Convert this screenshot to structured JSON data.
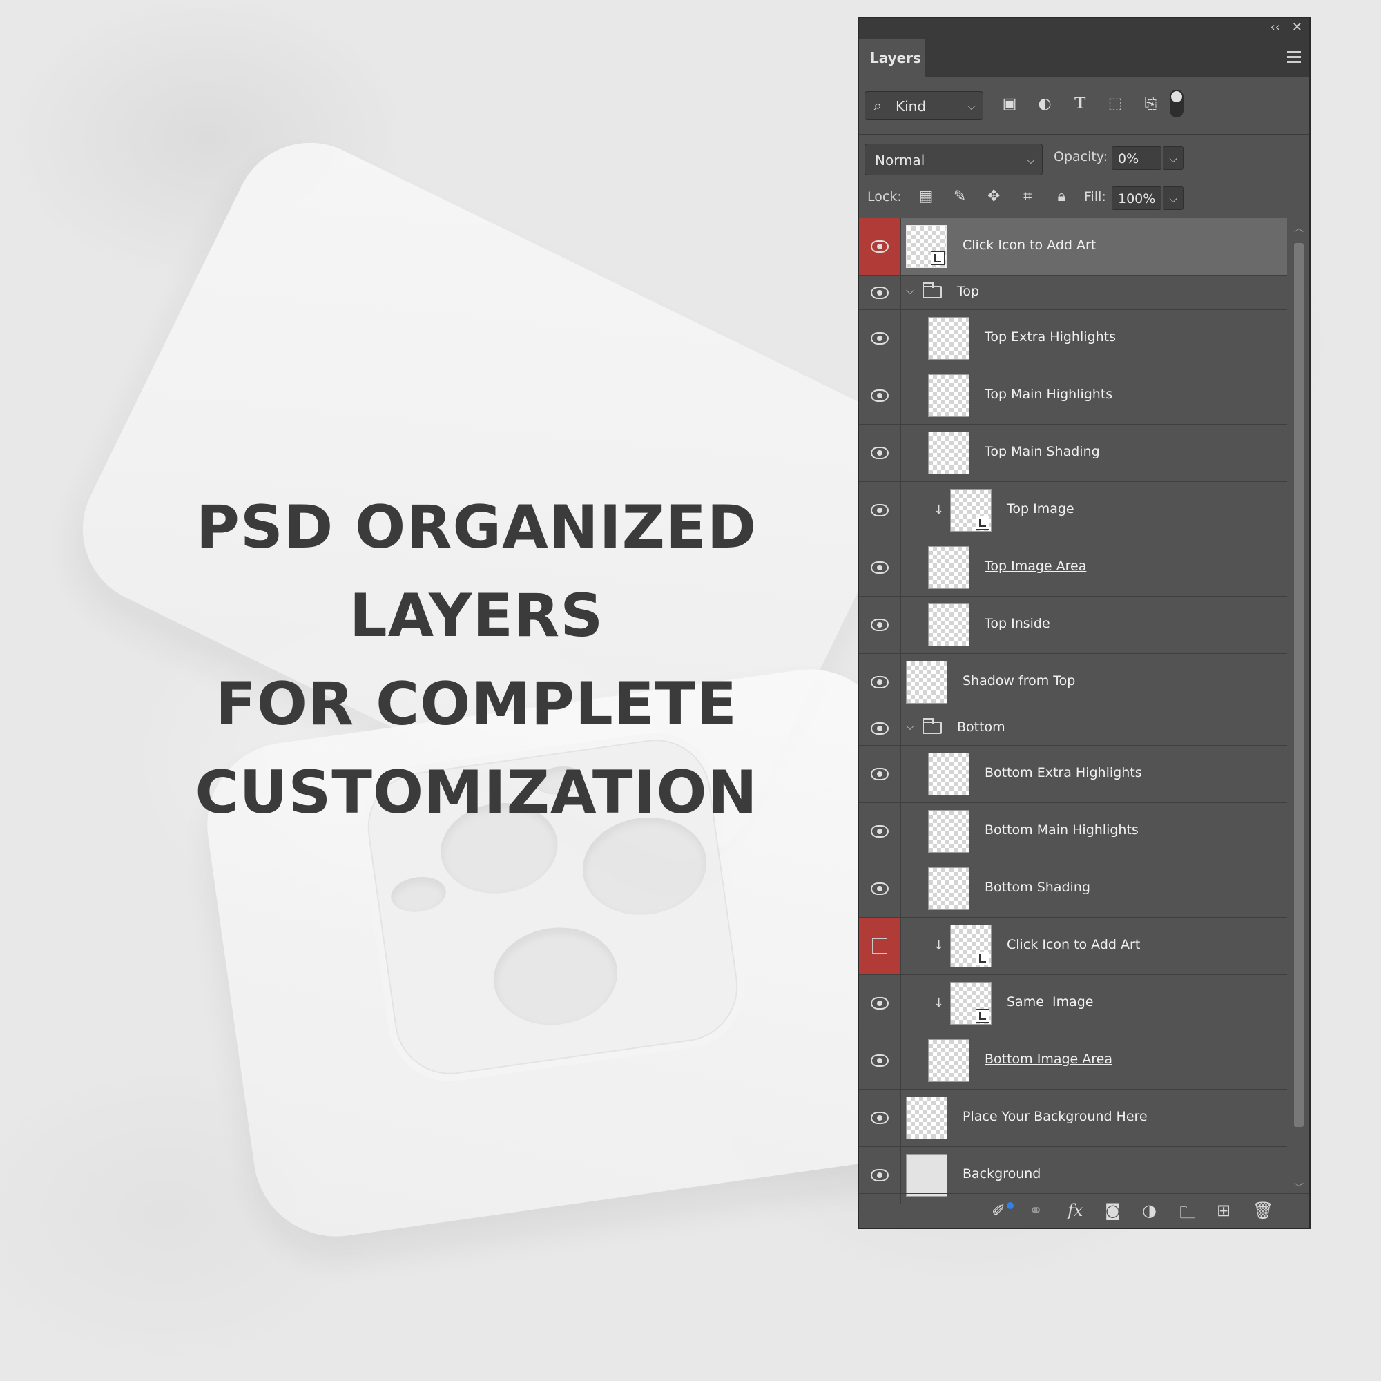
{
  "headline": {
    "line1": "PSD ORGANIZED LAYERS",
    "line2": "FOR COMPLETE",
    "line3": "CUSTOMIZATION"
  },
  "panel": {
    "title": "Layers",
    "collapse_glyph": "‹‹",
    "close_glyph": "✕",
    "filter": {
      "kind_label": "Kind"
    },
    "blend_mode": "Normal",
    "opacity_label": "Opacity:",
    "opacity_value": "0%",
    "lock_label": "Lock:",
    "fill_label": "Fill:",
    "fill_value": "100%"
  },
  "layers": [
    {
      "name": "Click Icon to Add Art",
      "type": "smart",
      "indent": 0,
      "selected": true,
      "visible": true,
      "red_eye": true
    },
    {
      "name": "Top",
      "type": "group",
      "indent": 0,
      "visible": true
    },
    {
      "name": "Top Extra Highlights",
      "type": "layer",
      "indent": 1,
      "visible": true
    },
    {
      "name": "Top Main Highlights",
      "type": "layer",
      "indent": 1,
      "visible": true
    },
    {
      "name": "Top Main Shading",
      "type": "layer",
      "indent": 1,
      "visible": true
    },
    {
      "name": "Top Image",
      "type": "smart",
      "indent": 2,
      "clipped": true,
      "visible": true
    },
    {
      "name": "Top Image Area",
      "type": "layer",
      "indent": 1,
      "underline": true,
      "visible": true
    },
    {
      "name": "Top Inside",
      "type": "layer",
      "indent": 1,
      "visible": true
    },
    {
      "name": "Shadow from Top",
      "type": "layer",
      "indent": 0,
      "visible": true
    },
    {
      "name": "Bottom",
      "type": "group",
      "indent": 0,
      "visible": true
    },
    {
      "name": "Bottom Extra Highlights",
      "type": "layer",
      "indent": 1,
      "visible": true
    },
    {
      "name": "Bottom Main Highlights",
      "type": "layer",
      "indent": 1,
      "visible": true
    },
    {
      "name": "Bottom Shading",
      "type": "layer",
      "indent": 1,
      "visible": true
    },
    {
      "name": "Click Icon to Add Art",
      "type": "smart",
      "indent": 2,
      "clipped": true,
      "visible": false,
      "red_eye": true
    },
    {
      "name": "Same  Image",
      "type": "smart",
      "indent": 2,
      "clipped": true,
      "visible": true
    },
    {
      "name": "Bottom Image Area",
      "type": "layer",
      "indent": 1,
      "underline": true,
      "visible": true
    },
    {
      "name": "Place Your Background Here",
      "type": "layer",
      "indent": 0,
      "visible": true
    },
    {
      "name": "Background",
      "type": "background",
      "indent": 0,
      "visible": true
    }
  ],
  "footer_icons": [
    "link-icon",
    "fx-icon",
    "mask-icon",
    "adjustment-icon",
    "folder-icon",
    "new-layer-icon",
    "trash-icon"
  ],
  "colors": {
    "panel_bg": "#535353",
    "selected_bg": "#6a6a6a",
    "eye_highlight": "#b03b37",
    "headline": "#3b3b3b"
  }
}
